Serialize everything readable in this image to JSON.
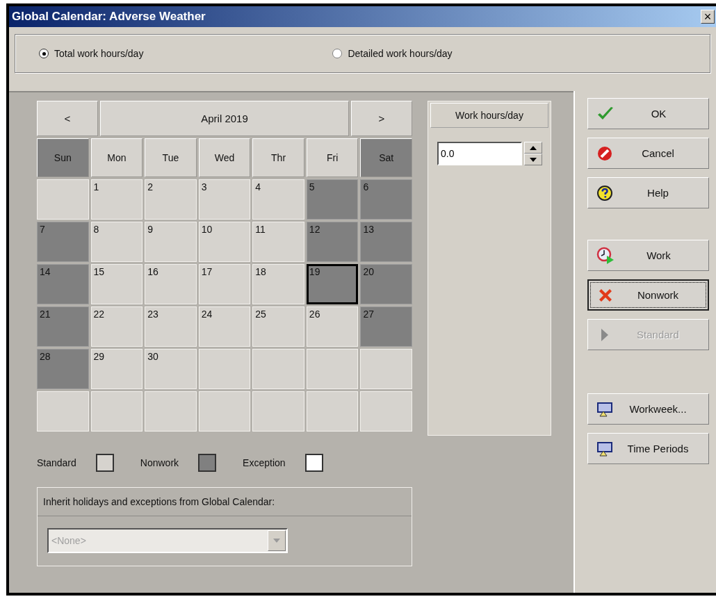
{
  "window": {
    "title": "Global Calendar: Adverse Weather",
    "close": "×"
  },
  "hours_mode": [
    {
      "label": "Total work hours/day",
      "selected": true
    },
    {
      "label": "Detailed work hours/day",
      "selected": false
    }
  ],
  "calendar": {
    "prev": "<",
    "month": "April 2019",
    "next": ">",
    "weekdays": [
      {
        "label": "Sun",
        "nonwork": true
      },
      {
        "label": "Mon",
        "nonwork": false
      },
      {
        "label": "Tue",
        "nonwork": false
      },
      {
        "label": "Wed",
        "nonwork": false
      },
      {
        "label": "Thr",
        "nonwork": false
      },
      {
        "label": "Fri",
        "nonwork": false
      },
      {
        "label": "Sat",
        "nonwork": true
      }
    ],
    "weeks": [
      [
        {
          "nonwork": false,
          "selected": false
        },
        {
          "day": "1",
          "nonwork": false,
          "selected": false
        },
        {
          "day": "2",
          "nonwork": false,
          "selected": false
        },
        {
          "day": "3",
          "nonwork": false,
          "selected": false
        },
        {
          "day": "4",
          "nonwork": false,
          "selected": false
        },
        {
          "day": "5",
          "nonwork": true,
          "selected": false
        },
        {
          "day": "6",
          "nonwork": true,
          "selected": false
        }
      ],
      [
        {
          "day": "7",
          "nonwork": true,
          "selected": false
        },
        {
          "day": "8",
          "nonwork": false,
          "selected": false
        },
        {
          "day": "9",
          "nonwork": false,
          "selected": false
        },
        {
          "day": "10",
          "nonwork": false,
          "selected": false
        },
        {
          "day": "11",
          "nonwork": false,
          "selected": false
        },
        {
          "day": "12",
          "nonwork": true,
          "selected": false
        },
        {
          "day": "13",
          "nonwork": true,
          "selected": false
        }
      ],
      [
        {
          "day": "14",
          "nonwork": true,
          "selected": false
        },
        {
          "day": "15",
          "nonwork": false,
          "selected": false
        },
        {
          "day": "16",
          "nonwork": false,
          "selected": false
        },
        {
          "day": "17",
          "nonwork": false,
          "selected": false
        },
        {
          "day": "18",
          "nonwork": false,
          "selected": false
        },
        {
          "day": "19",
          "nonwork": true,
          "selected": true
        },
        {
          "day": "20",
          "nonwork": true,
          "selected": false
        }
      ],
      [
        {
          "day": "21",
          "nonwork": true,
          "selected": false
        },
        {
          "day": "22",
          "nonwork": false,
          "selected": false
        },
        {
          "day": "23",
          "nonwork": false,
          "selected": false
        },
        {
          "day": "24",
          "nonwork": false,
          "selected": false
        },
        {
          "day": "25",
          "nonwork": false,
          "selected": false
        },
        {
          "day": "26",
          "nonwork": false,
          "selected": false
        },
        {
          "day": "27",
          "nonwork": true,
          "selected": false
        }
      ],
      [
        {
          "day": "28",
          "nonwork": true,
          "selected": false
        },
        {
          "day": "29",
          "nonwork": false,
          "selected": false
        },
        {
          "day": "30",
          "nonwork": false,
          "selected": false
        },
        {
          "nonwork": false,
          "selected": false
        },
        {
          "nonwork": false,
          "selected": false
        },
        {
          "nonwork": false,
          "selected": false
        },
        {
          "nonwork": false,
          "selected": false
        }
      ],
      [
        {
          "nonwork": false,
          "selected": false
        },
        {
          "nonwork": false,
          "selected": false
        },
        {
          "nonwork": false,
          "selected": false
        },
        {
          "nonwork": false,
          "selected": false
        },
        {
          "nonwork": false,
          "selected": false
        },
        {
          "nonwork": false,
          "selected": false
        },
        {
          "nonwork": false,
          "selected": false
        }
      ]
    ]
  },
  "work_hours": {
    "heading": "Work hours/day",
    "value": "0.0"
  },
  "legend": [
    {
      "label": "Standard",
      "color": "#d6d3ce"
    },
    {
      "label": "Nonwork",
      "color": "#808080"
    },
    {
      "label": "Exception",
      "color": "#ffffff"
    }
  ],
  "inherit": {
    "label": "Inherit holidays and exceptions from Global Calendar:",
    "value": "<None>",
    "disabled": true
  },
  "button_groups": [
    [
      {
        "label": "OK",
        "kind": "ok",
        "focused": false,
        "disabled": false
      },
      {
        "label": "Cancel",
        "kind": "cancel",
        "focused": false,
        "disabled": false
      },
      {
        "label": "Help",
        "kind": "help",
        "focused": false,
        "disabled": false
      }
    ],
    [
      {
        "label": "Work",
        "kind": "work",
        "focused": false,
        "disabled": false
      },
      {
        "label": "Nonwork",
        "kind": "nonwork",
        "focused": true,
        "disabled": false
      },
      {
        "label": "Standard",
        "kind": "standard",
        "focused": false,
        "disabled": true
      }
    ],
    [
      {
        "label": "Workweek...",
        "kind": "dialog",
        "focused": false,
        "disabled": false
      },
      {
        "label": "Time Periods",
        "kind": "dialog",
        "focused": false,
        "disabled": false
      }
    ]
  ]
}
